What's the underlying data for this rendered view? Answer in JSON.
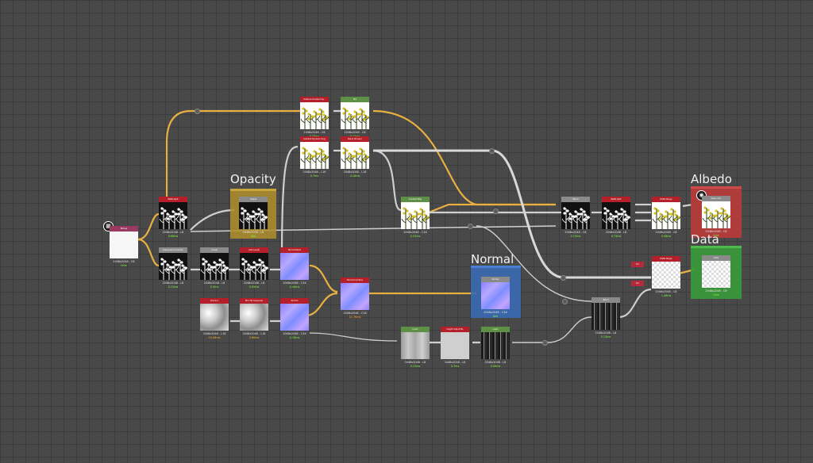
{
  "colors": {
    "opacity_frame": "#b08e2c",
    "normal_frame": "#3a6ab4",
    "albedo_frame": "#b83b3b",
    "data_frame": "#3a9a3a",
    "wire_yellow": "#e8b040",
    "wire_white": "#cfcfcf",
    "hdr_red": "#b41f2a",
    "hdr_grey": "#8a8a8a",
    "hdr_green": "#5d8f45",
    "hdr_magenta": "#9a3a62"
  },
  "frames": {
    "opacity": {
      "title": "Opacity"
    },
    "normal": {
      "title": "Normal"
    },
    "albedo": {
      "title": "Albedo"
    },
    "data": {
      "title": "Data"
    }
  },
  "nodes": [
    {
      "id": "n_input",
      "header": "Bitmap",
      "sub": "2048x2048 - C8",
      "time": "0ms"
    },
    {
      "id": "n_split",
      "header": "RGBA Split",
      "sub": "2048x2048 - L8",
      "time": "0.66ms"
    },
    {
      "id": "n_grad",
      "header": "Grayscale Conversion",
      "sub": "2048x2048 - L8",
      "time": "0.21ms"
    },
    {
      "id": "n_opacity_out",
      "header": "Output",
      "sub": "2048x2048 - L8",
      "time": "N/A"
    },
    {
      "id": "n_levels",
      "header": "Levels",
      "sub": "2048x2048 - L8",
      "time": "0.3ms"
    },
    {
      "id": "n_ao",
      "header": "Auto Levels",
      "sub": "2048x2048 - L8",
      "time": "0.09ms"
    },
    {
      "id": "n_nblend",
      "header": "Normal Blend",
      "sub": "2048x2048 - C16",
      "time": "0.44ms"
    },
    {
      "id": "n_clouds",
      "header": "Clouds 2",
      "sub": "2048x2048 - L16",
      "time": "19.48ms",
      "warn": true
    },
    {
      "id": "n_blur",
      "header": "Blur HQ Grayscale",
      "sub": "2048x2048 - L16",
      "time": "3.86ms",
      "warn": true
    },
    {
      "id": "n_normal2",
      "header": "Normal",
      "sub": "2048x2048 - C16",
      "time": "0.18ms"
    },
    {
      "id": "n_top1",
      "header": "Distance Gradient Dy...",
      "sub": "2048x2048 - C8",
      "time": "0.28ms"
    },
    {
      "id": "n_top2",
      "header": "Mix",
      "sub": "2048x2048 - C8",
      "time": "0.13ms"
    },
    {
      "id": "n_mid1",
      "header": "Gradient Dynamic Gray",
      "sub": "2048x2048 - L16",
      "time": "0.7ms"
    },
    {
      "id": "n_mid2",
      "header": "Blend (Screen)",
      "sub": "2048x2048 - L16",
      "time": "4.18ms"
    },
    {
      "id": "n_combine",
      "header": "Gradient Map",
      "sub": "2048x2048 - C16",
      "time": "0.31ms"
    },
    {
      "id": "n_warp",
      "header": "Normal Combine",
      "sub": "2048x2048 - C16",
      "time": "11.76ms",
      "warn": true
    },
    {
      "id": "n_normal_out",
      "header": "Normal",
      "sub": "2048x2048 - C16",
      "time": "N/A"
    },
    {
      "id": "n_g1",
      "header": "Invert",
      "sub": "2048x2048 - L8",
      "time": "0.15ms"
    },
    {
      "id": "n_g2",
      "header": "Height Output ML",
      "sub": "2048x2048 - L8",
      "time": "0.7ms"
    },
    {
      "id": "n_g3",
      "header": "Invert",
      "sub": "2048x2048 - L8",
      "time": "0.06ms"
    },
    {
      "id": "n_dark",
      "header": "Blend",
      "sub": "2048x2048 - L8",
      "time": "0.13ms"
    },
    {
      "id": "n_blend_big",
      "header": "Blend",
      "sub": "2048x2048 - C8",
      "time": "0.13ms"
    },
    {
      "id": "n_split2",
      "header": "RGBA Split",
      "sub": "2048x2048 - L8",
      "time": "0.74ms"
    },
    {
      "id": "n_merge",
      "header": "RGBA Merge",
      "sub": "2048x2048 - C8",
      "time": "0.36ms"
    },
    {
      "id": "n_albedo_out",
      "header": "base_color",
      "sub": "2048x2048 - C8",
      "time": "0ms"
    },
    {
      "id": "n_merge2",
      "header": "RGBA Merge",
      "sub": "2048x2048 - C8",
      "time": "1.46ms"
    },
    {
      "id": "n_data_out",
      "header": "Data",
      "sub": "2048x2048 - C8",
      "time": "0ms"
    }
  ],
  "chips": {
    "c1": "0x",
    "c2": "0x"
  },
  "icons": {
    "input_badge": "checker-icon",
    "albedo_badge": "camera-icon"
  }
}
